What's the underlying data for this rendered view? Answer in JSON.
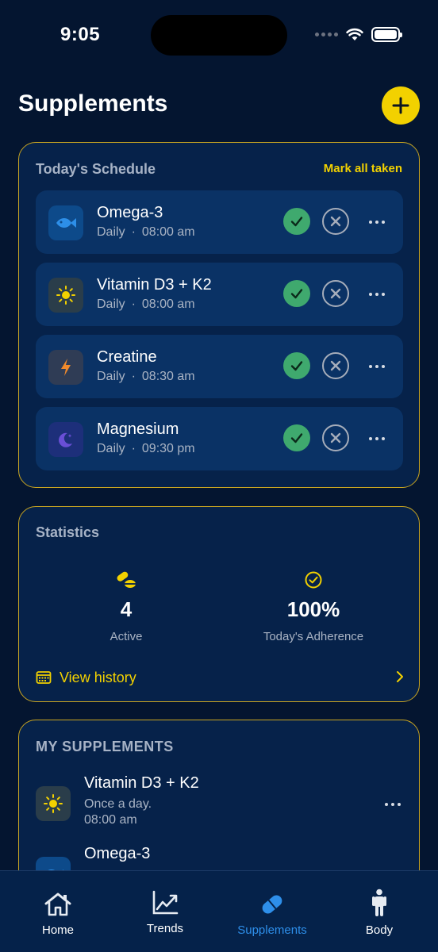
{
  "status_bar": {
    "time": "9:05"
  },
  "header": {
    "title": "Supplements",
    "add_icon": "plus-icon"
  },
  "colors": {
    "accent": "#f2d100",
    "taken": "#3fa96e",
    "active_tab": "#2e8fea",
    "background": "#041530"
  },
  "schedule": {
    "title": "Today's Schedule",
    "mark_all_label": "Mark all taken",
    "items": [
      {
        "name": "Omega-3",
        "frequency": "Daily",
        "separator": "·",
        "time": "08:00 am",
        "icon": "fish-icon"
      },
      {
        "name": "Vitamin D3 + K2",
        "frequency": "Daily",
        "separator": "·",
        "time": "08:00 am",
        "icon": "sun-icon"
      },
      {
        "name": "Creatine",
        "frequency": "Daily",
        "separator": "·",
        "time": "08:30 am",
        "icon": "bolt-icon"
      },
      {
        "name": "Magnesium",
        "frequency": "Daily",
        "separator": "·",
        "time": "09:30 pm",
        "icon": "moon-icon"
      }
    ]
  },
  "statistics": {
    "title": "Statistics",
    "active": {
      "value": "4",
      "label": "Active",
      "icon": "pills-icon"
    },
    "adherence": {
      "value": "100%",
      "label": "Today's Adherence",
      "icon": "check-circle-icon"
    },
    "history_label": "View history"
  },
  "my_supplements": {
    "title": "MY SUPPLEMENTS",
    "items": [
      {
        "name": "Vitamin D3 + K2",
        "line1": "Once a day.",
        "line2": "08:00 am",
        "icon": "sun-icon"
      },
      {
        "name": "Omega-3",
        "line1": "",
        "line2": "",
        "icon": "fish-icon"
      }
    ]
  },
  "tabs": [
    {
      "label": "Home",
      "icon": "home-icon"
    },
    {
      "label": "Trends",
      "icon": "trends-icon"
    },
    {
      "label": "Supplements",
      "icon": "pill-icon",
      "active": true
    },
    {
      "label": "Body",
      "icon": "body-icon"
    }
  ]
}
